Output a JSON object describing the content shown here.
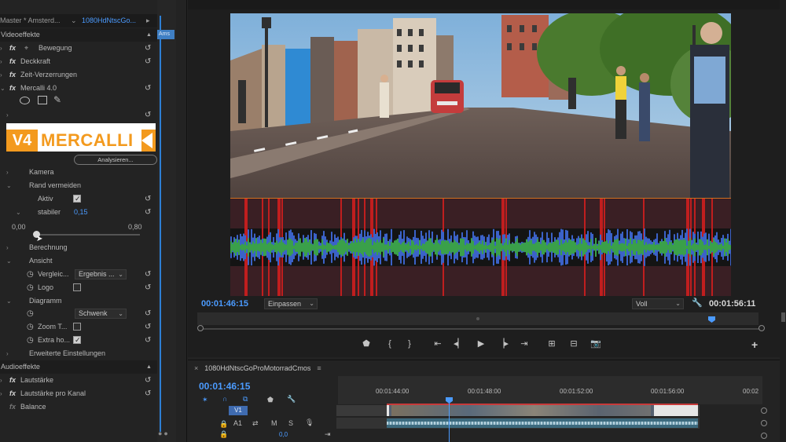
{
  "effects_panel": {
    "master_label": "Master * Amsterd...",
    "clip_name": "1080HdNtscGo...",
    "mini_clip_label": "Ams",
    "video_effects_header": "Videoeffekte",
    "audio_effects_header": "Audioeffekte",
    "analyze_button": "Analysieren...",
    "slider_min": "0,00",
    "slider_max": "0,80",
    "slider_value_fraction": 0.0,
    "rows": {
      "bewegung": "Bewegung",
      "deckkraft": "Deckkraft",
      "zeit": "Zeit-Verzerrungen",
      "mercalli": "Mercalli 4.0",
      "kamera": "Kamera",
      "rand": "Rand vermeiden",
      "aktiv": "Aktiv",
      "stabiler": "stabiler",
      "stabiler_value": "0,15",
      "berechnung": "Berechnung",
      "ansicht": "Ansicht",
      "vergleich": "Vergleic...",
      "vergleich_value": "Ergebnis ...",
      "logo": "Logo",
      "diagramm": "Diagramm",
      "schwenk_value": "Schwenk",
      "zoom": "Zoom T...",
      "extra": "Extra ho...",
      "erweitert": "Erweiterte Einstellungen",
      "lautstaerke": "Lautstärke",
      "lautstaerke_kanal": "Lautstärke pro Kanal",
      "balance": "Balance"
    },
    "logo": {
      "badge": "V4",
      "name": "MERCALLI"
    }
  },
  "monitor": {
    "timecode": "00:01:46:15",
    "fit_select": "Einpassen",
    "quality_select": "Voll",
    "duration": "00:01:56:11"
  },
  "timeline": {
    "sequence_name": "1080HdNtscGoProMotorradCmos",
    "timecode": "00:01:46:15",
    "ruler_ticks": [
      "00:01:44:00",
      "00:01:48:00",
      "00:01:52:00",
      "00:01:56:00",
      "00:02"
    ],
    "v1_label": "V1",
    "a1_label": "A1",
    "m_label": "M",
    "s_label": "S",
    "volume_value": "0,0"
  },
  "colors": {
    "accent_blue": "#4b9bff",
    "mercalli_orange": "#f39a1e",
    "waveform_red": "#c01e1e"
  }
}
